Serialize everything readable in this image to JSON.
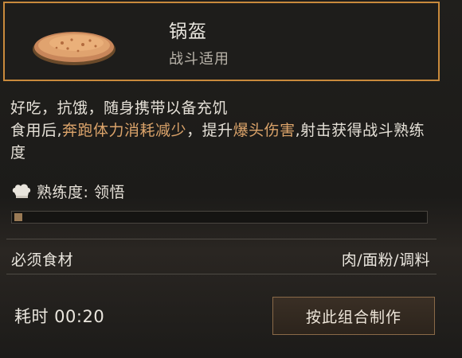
{
  "item": {
    "icon": "naan-bread-icon",
    "name": "锅盔",
    "subtitle": "战斗适用"
  },
  "description": {
    "line1": "好吃，抗饿，随身携带以备充饥",
    "line2_prefix": "食用后,",
    "line2_highlight1": "奔跑体力消耗减少",
    "line2_mid": "，提升",
    "line2_highlight2": "爆头伤害",
    "line2_suffix": ",射击获得战斗熟练度"
  },
  "proficiency": {
    "icon": "chef-hat-icon",
    "label": "熟练度: 领悟",
    "progress": 0.02
  },
  "ingredients": {
    "label": "必须食材",
    "value": "肉/面粉/调料"
  },
  "time": {
    "label": "耗时 00:20"
  },
  "craft_button": {
    "label": "按此组合制作"
  },
  "colors": {
    "accent_border": "#c98a3c",
    "highlight_text": "#dba36a"
  }
}
